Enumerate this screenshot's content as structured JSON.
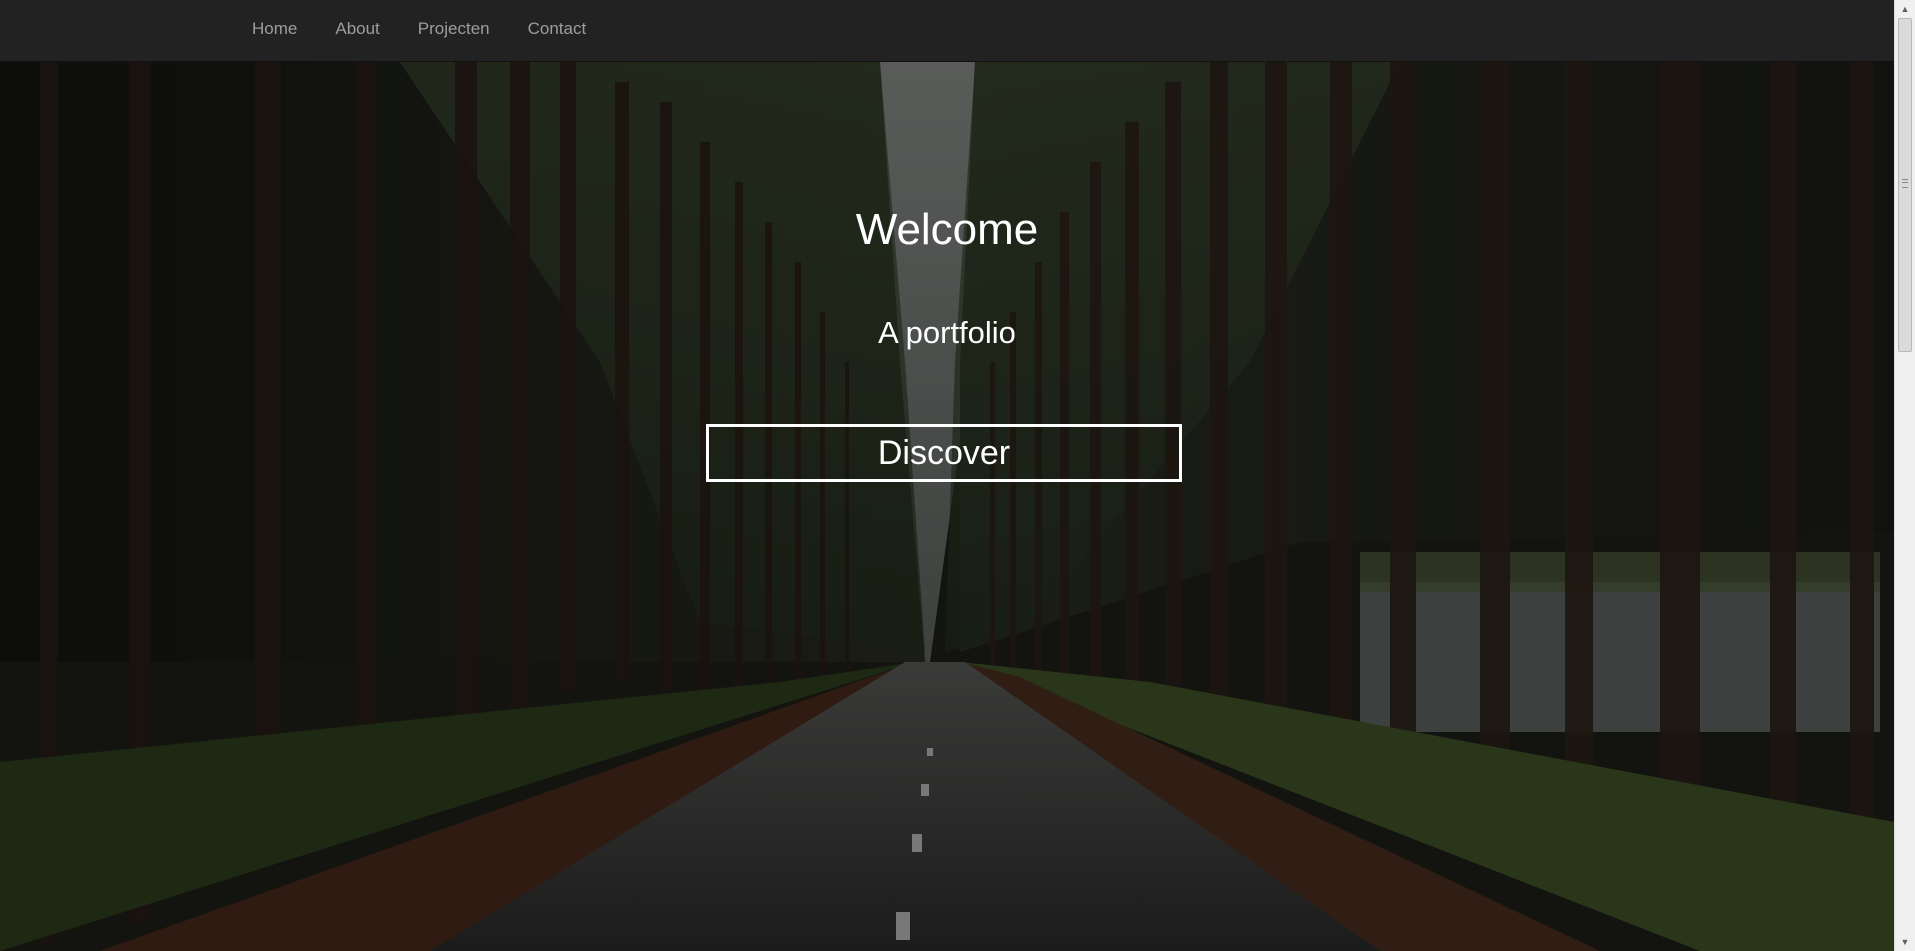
{
  "navbar": {
    "items": [
      {
        "label": "Home"
      },
      {
        "label": "About"
      },
      {
        "label": "Projecten"
      },
      {
        "label": "Contact"
      }
    ]
  },
  "hero": {
    "title": "Welcome",
    "subtitle": "A portfolio",
    "button_label": "Discover",
    "background": "forest road photo"
  },
  "colors": {
    "navbar_bg": "#222222",
    "nav_text": "#9d9d9d",
    "hero_text": "#ffffff",
    "button_border": "#ffffff"
  },
  "scrollbar": {
    "up_icon": "arrow-up-icon",
    "down_icon": "arrow-down-icon"
  }
}
